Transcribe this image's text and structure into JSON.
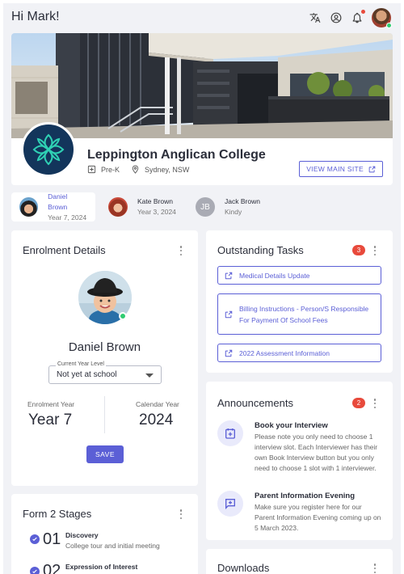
{
  "header": {
    "greeting": "Hi Mark!"
  },
  "school": {
    "name": "Leppington Anglican College",
    "level": "Pre-K",
    "location": "Sydney, NSW",
    "view_site_label": "VIEW MAIN SITE"
  },
  "children": [
    {
      "name": "Daniel Brown",
      "detail": "Year 7, 2024",
      "active": true
    },
    {
      "name": "Kate Brown",
      "detail": "Year 3, 2024",
      "active": false
    },
    {
      "name": "Jack Brown",
      "detail": "Kindy",
      "initials": "JB",
      "active": false
    }
  ],
  "enrolment": {
    "title": "Enrolment Details",
    "student_name": "Daniel Brown",
    "year_level_label": "Current Year Level",
    "year_level_value": "Not yet at school",
    "enrolment_year_label": "Enrolment Year",
    "enrolment_year_value": "Year 7",
    "calendar_year_label": "Calendar Year",
    "calendar_year_value": "2024",
    "save_label": "SAVE"
  },
  "tasks": {
    "title": "Outstanding Tasks",
    "count": "3",
    "items": [
      "Medical Details Update",
      "Billing Instructions - Person/S Responsible For Payment Of School Fees",
      "2022 Assessment Information"
    ]
  },
  "announcements": {
    "title": "Announcements",
    "count": "2",
    "items": [
      {
        "title": "Book your Interview",
        "body": "Please note you only need to choose 1 interview slot. Each Interviewer has their own Book Interview button but you only need to choose 1 slot with 1 interviewer."
      },
      {
        "title": "Parent Information Evening",
        "body": "Make sure you register here for our Parent Information Evening coming up on 5 March 2023."
      }
    ]
  },
  "stages": {
    "title": "Form 2 Stages",
    "items": [
      {
        "num": "01",
        "title": "Discovery",
        "sub": "College tour and initial meeting"
      },
      {
        "num": "02",
        "title": "Expression of Interest",
        "sub": ""
      }
    ]
  },
  "downloads": {
    "title": "Downloads"
  },
  "colors": {
    "accent": "#5b5fd6",
    "badge": "#e84a3c",
    "online": "#2ecc71",
    "background": "#f1f2f6"
  }
}
